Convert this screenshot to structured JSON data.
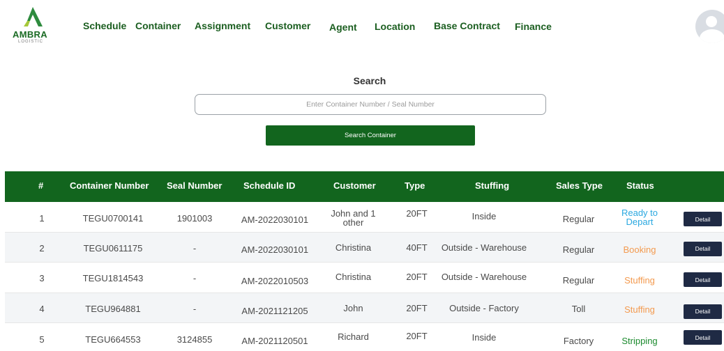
{
  "brand": {
    "name": "AMBRA",
    "tagline": "LOGISTIC"
  },
  "nav": [
    {
      "label": "Schedule"
    },
    {
      "label": "Container"
    },
    {
      "label": "Assignment"
    },
    {
      "label": "Customer"
    },
    {
      "label": "Agent"
    },
    {
      "label": "Location"
    },
    {
      "label": "Base Contract"
    },
    {
      "label": "Finance"
    }
  ],
  "search": {
    "title": "Search",
    "placeholder": "Enter Container Number / Seal Number",
    "value": "",
    "button_label": "Search Container"
  },
  "table": {
    "headers": [
      "#",
      "Container Number",
      "Seal Number",
      "Schedule ID",
      "Customer",
      "Type",
      "Stuffing",
      "Sales Type",
      "Status"
    ],
    "detail_label": "Detail",
    "rows": [
      {
        "no": "1",
        "container": "TEGU0700141",
        "seal": "1901003",
        "schedule": "AM-2022030101",
        "customer": "John and 1 other",
        "type": "20FT",
        "stuffing": "Inside",
        "sales": "Regular",
        "status": "Ready to Depart",
        "status_color": "#2aa8e0"
      },
      {
        "no": "2",
        "container": "TEGU0611175",
        "seal": "-",
        "schedule": "AM-2022030101",
        "customer": "Christina",
        "type": "40FT",
        "stuffing": "Outside - Warehouse",
        "sales": "Regular",
        "status": "Booking",
        "status_color": "#f39a4f"
      },
      {
        "no": "3",
        "container": "TEGU1814543",
        "seal": "-",
        "schedule": "AM-2022010503",
        "customer": "Christina",
        "type": "20FT",
        "stuffing": "Outside - Warehouse",
        "sales": "Regular",
        "status": "Stuffing",
        "status_color": "#f39a4f"
      },
      {
        "no": "4",
        "container": "TEGU964881",
        "seal": "-",
        "schedule": "AM-2021121205",
        "customer": "John",
        "type": "20FT",
        "stuffing": "Outside - Factory",
        "sales": "Toll",
        "status": "Stuffing",
        "status_color": "#f39a4f"
      },
      {
        "no": "5",
        "container": "TEGU664553",
        "seal": "3124855",
        "schedule": "AM-2021120501",
        "customer": "Richard",
        "type": "20FT",
        "stuffing": "Inside",
        "sales": "Factory",
        "status": "Stripping",
        "status_color": "#1b8a2e"
      }
    ]
  },
  "colors": {
    "primary": "#12651e",
    "nav_text": "#1b5e20",
    "detail_button": "#1f2a44"
  },
  "icons": {
    "logo": "ambra-logo-icon",
    "avatar": "user-avatar-icon"
  }
}
